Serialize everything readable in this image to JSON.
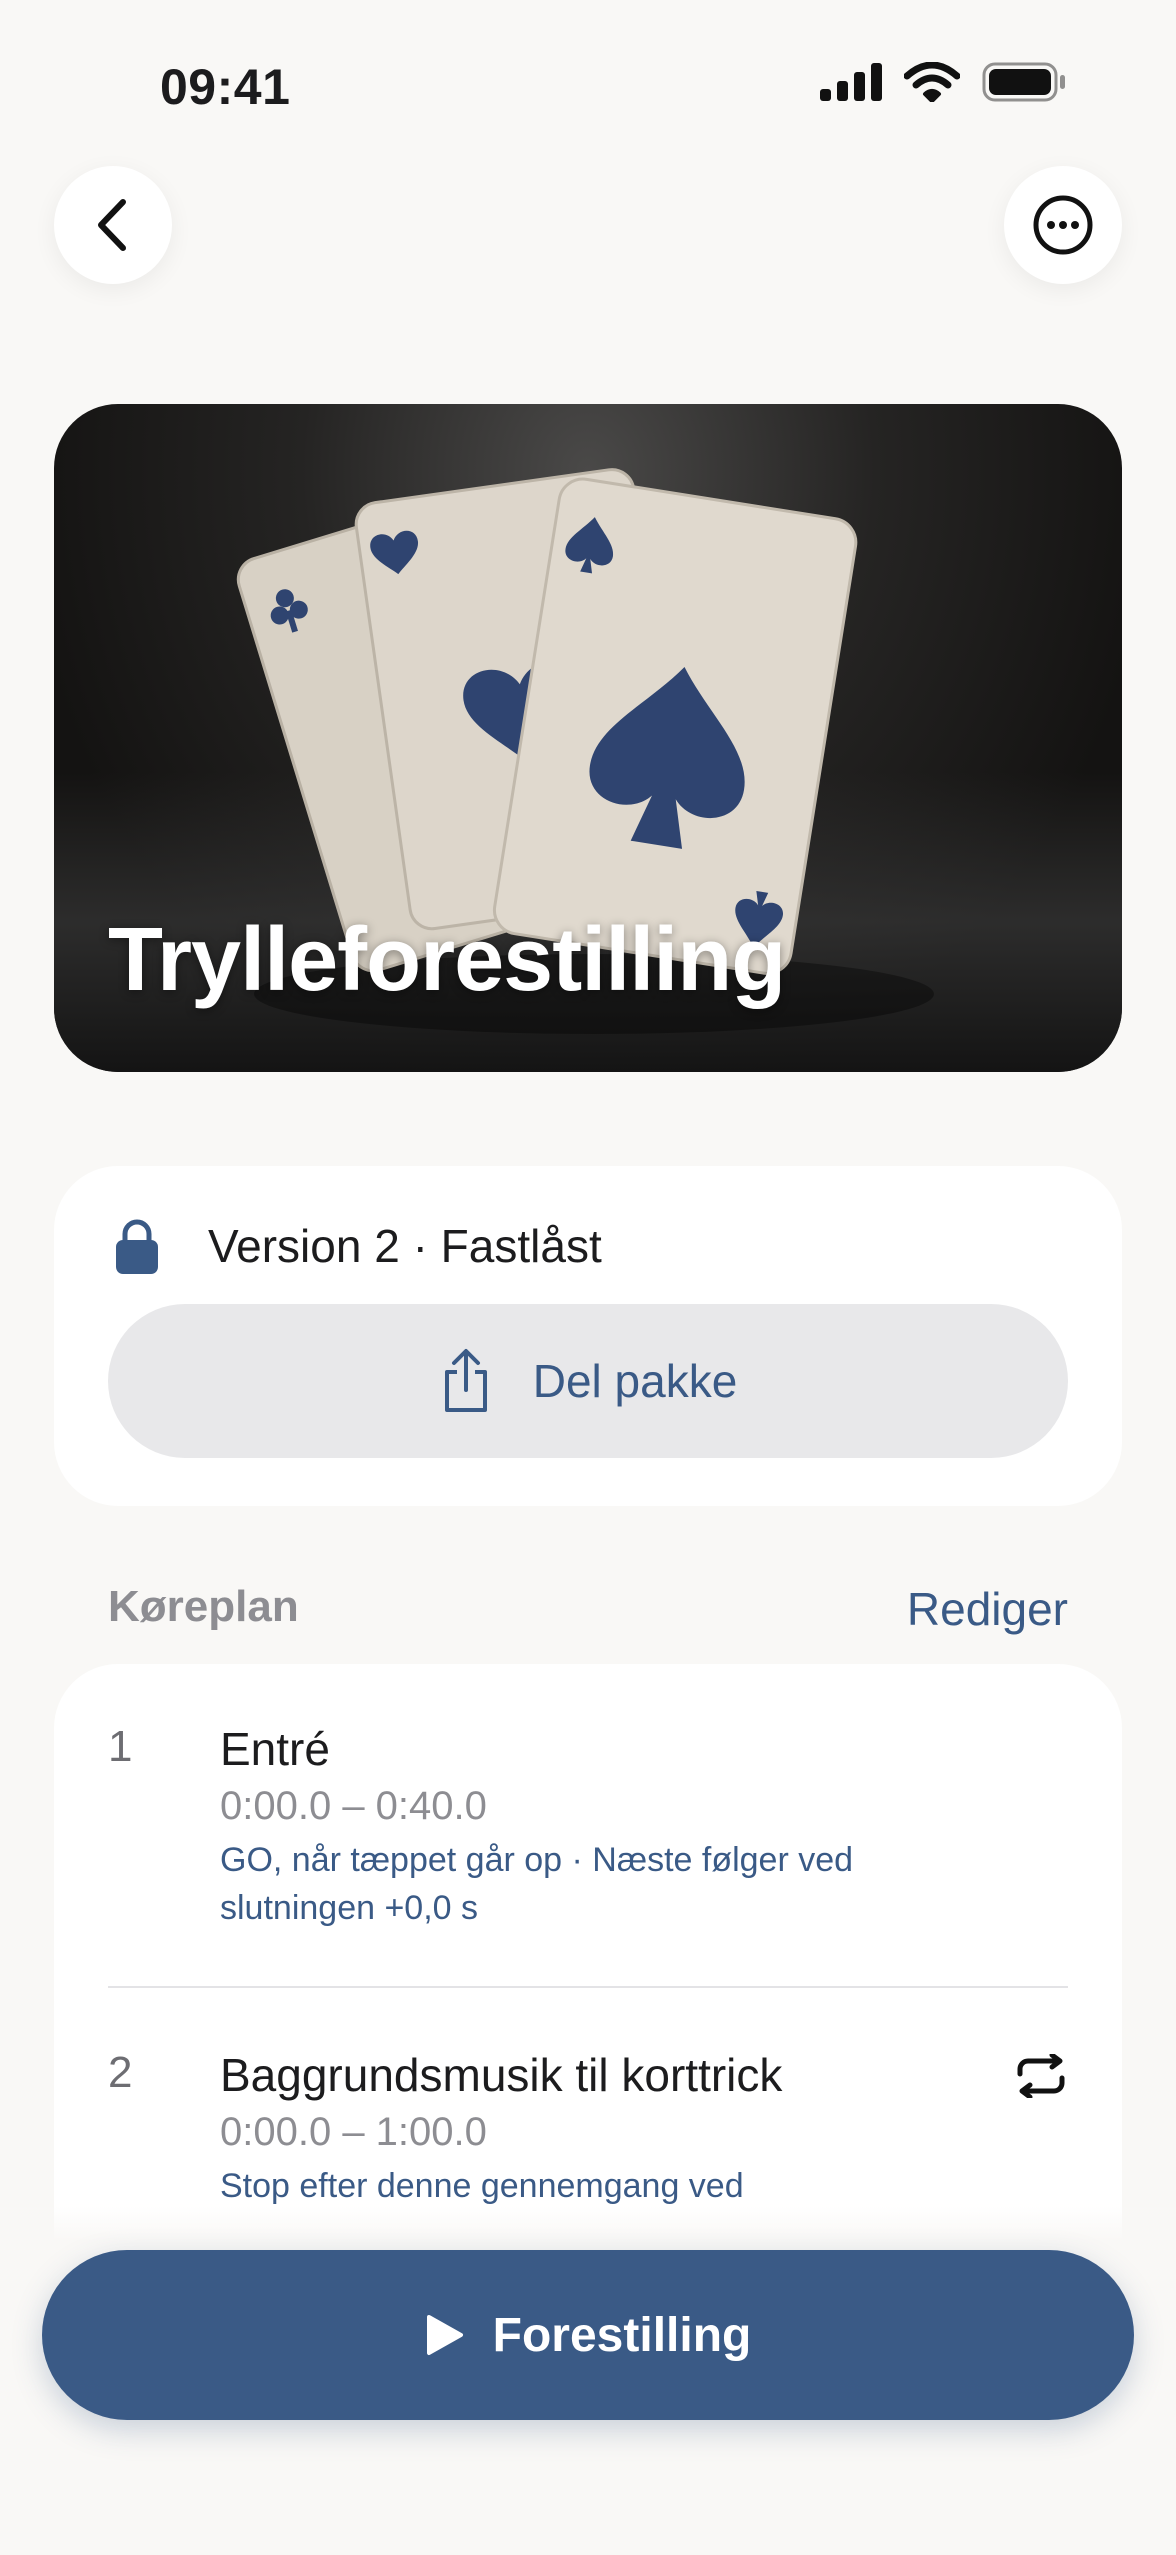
{
  "status_bar": {
    "time": "09:41",
    "icons": [
      "cellular-signal-icon",
      "wifi-icon",
      "battery-icon"
    ]
  },
  "nav": {
    "back_icon": "chevron-left-icon",
    "more_icon": "ellipsis-circle-icon"
  },
  "hero": {
    "title": "Trylleforestilling",
    "image": "playing-cards-image"
  },
  "version": {
    "text": "Version 2 · Fastlåst",
    "icon": "lock-icon",
    "share_label": "Del pakke",
    "share_icon": "share-icon"
  },
  "schedule": {
    "title": "Køreplan",
    "edit_label": "Rediger",
    "items": [
      {
        "number": "1",
        "title": "Entré",
        "time": "0:00.0 – 0:40.0",
        "note": "GO, når tæppet går op · Næste følger ved slutningen +0,0 s"
      },
      {
        "number": "2",
        "title": "Baggrundsmusik til korttrick",
        "time": "0:00.0 – 1:00.0",
        "note": "Stop efter denne gennemgang ved",
        "icon": "repeat-icon"
      }
    ]
  },
  "primary_action": {
    "label": "Forestilling",
    "icon": "play-icon"
  },
  "colors": {
    "accent": "#3a5a86",
    "background": "#f9f8f6",
    "card": "#ffffff",
    "secondary_text": "#8d8d92"
  }
}
